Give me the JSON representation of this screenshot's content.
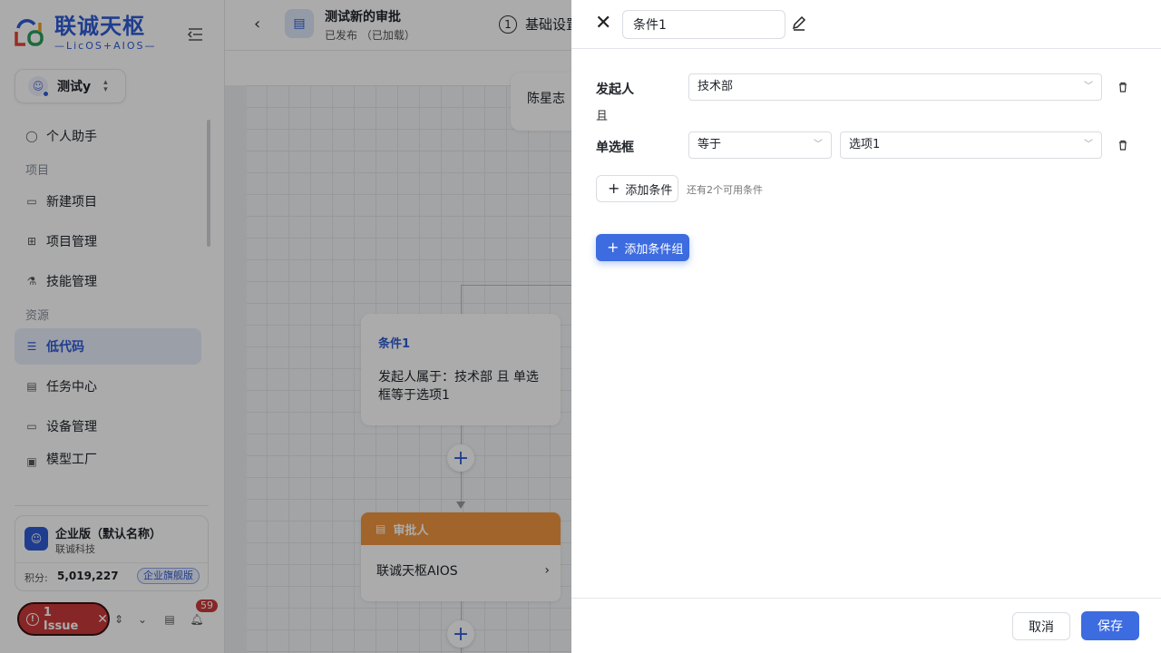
{
  "brand": {
    "name_cn": "联诚天枢",
    "name_en": "—LicOS+AIOS—"
  },
  "workspace": {
    "name": "测试y"
  },
  "nav": {
    "assistant": "个人助手",
    "section_project": "项目",
    "new_project": "新建项目",
    "project_mgmt": "项目管理",
    "skill_mgmt": "技能管理",
    "section_resource": "资源",
    "lowcode": "低代码",
    "task_center": "任务中心",
    "device_mgmt": "设备管理",
    "model_factory": "模型工厂"
  },
  "enterprise": {
    "name": "企业版（默认名称）",
    "company": "联诚科技",
    "points_label": "积分:",
    "points_value": "5,019,227",
    "tier_badge": "企业旗舰版"
  },
  "issue": {
    "label": "1 Issue"
  },
  "notifications": {
    "count": "59"
  },
  "header": {
    "flow_title": "测试新的审批",
    "flow_status": "已发布 （已加载）",
    "step_number": "1",
    "step_label": "基础设置"
  },
  "canvas": {
    "top_card_text": "陈星志",
    "condition_card_title": "条件1",
    "condition_card_body": "发起人属于：技术部 且 单选框等于选项1",
    "approver_header": "审批人",
    "approver_body": "联诚天枢AIOS"
  },
  "drawer": {
    "condition_name": "条件1",
    "rows": [
      {
        "label": "发起人",
        "value": "技术部"
      },
      {
        "label": "单选框",
        "operator": "等于",
        "value": "选项1"
      }
    ],
    "conjunction": "且",
    "add_condition": "添加条件",
    "available_hint": "还有2个可用条件",
    "add_group": "添加条件组",
    "cancel": "取消",
    "save": "保存"
  },
  "colors": {
    "accent": "#3d6be0",
    "approver": "#f0953f",
    "issue": "#c93a3a"
  }
}
